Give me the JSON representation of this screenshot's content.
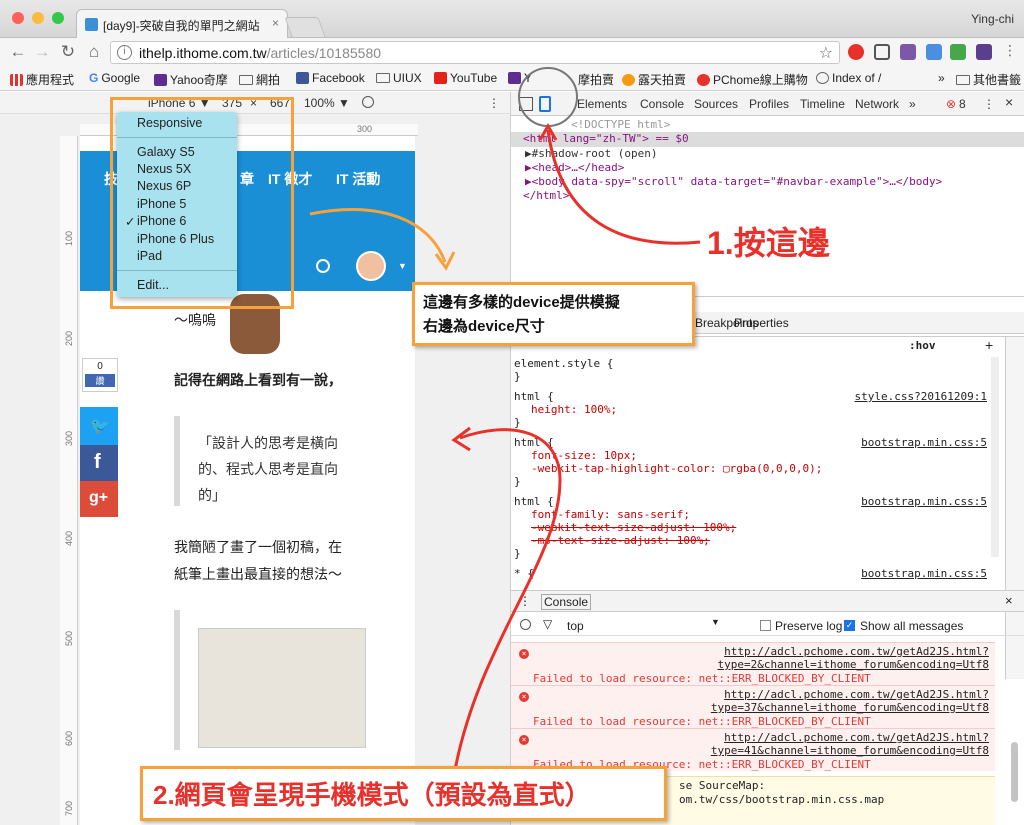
{
  "window": {
    "tab_title": "[day9]-突破自我的單門之網站",
    "user": "Ying-chi"
  },
  "address": {
    "host": "ithelp.ithome.com.tw",
    "path": "/articles/10185580"
  },
  "bookmarks": [
    "應用程式",
    "Google",
    "Yahoo奇摩",
    "網拍",
    "Facebook",
    "UIUX",
    "YouTube",
    "Y",
    "摩拍賣",
    "露天拍賣",
    "PChome線上購物",
    "Index of /",
    "»",
    "其他書籤"
  ],
  "device_toolbar": {
    "device": "iPhone 6 ▼",
    "width": "375",
    "times": "×",
    "height": "667",
    "zoom": "100% ▼"
  },
  "device_menu": {
    "items": [
      "Responsive",
      "Galaxy S5",
      "Nexus 5X",
      "Nexus 6P",
      "iPhone 5",
      "iPhone 6",
      "iPhone 6 Plus",
      "iPad",
      "Edit..."
    ],
    "checked": "✓"
  },
  "site": {
    "nav": [
      "技",
      "章",
      "IT 徵才",
      "IT 活動"
    ],
    "like_count": "0",
    "like_label": "讚",
    "text1": "～嗚嗚",
    "text2": "記得在網路上看到有一說，",
    "quote": [
      "「設計人的思考是橫向",
      "的、程式人思考是直向",
      "的」"
    ],
    "text3": [
      "我簡陋了畫了一個初稿，在",
      "紙筆上畫出最直接的想法～"
    ]
  },
  "ruler": {
    "top": [
      "100",
      "200",
      "300"
    ],
    "left": [
      "100",
      "200",
      "300",
      "400",
      "500",
      "600",
      "700"
    ]
  },
  "annotations": {
    "step1": "1.按這邊",
    "callout1": [
      "這邊有多樣的device提供模擬",
      "右邊為device尺寸"
    ],
    "step2": "2.網頁會呈現手機模式（預設為直式）"
  },
  "devtools": {
    "tabs": [
      "Elements",
      "Console",
      "Sources",
      "Profiles",
      "Timeline",
      "Network",
      "»"
    ],
    "error_count": "8",
    "dom": [
      "<!DOCTYPE html>",
      "<html lang=\"zh-TW\"> == $0",
      "▶#shadow-root (open)",
      "▶<head>…</head>",
      "▶<body data-spy=\"scroll\" data-target=\"#navbar-example\">…</body>",
      "</html>"
    ],
    "styles_tabs": [
      "Breakpoints",
      "Properties"
    ],
    "hov": ":hov",
    ".cls": ".cls",
    "plus": "+",
    "rules": [
      {
        "sel": "element.style {",
        "decls": [],
        "src": ""
      },
      {
        "sel": "html {",
        "decls": [
          "height: 100%;"
        ],
        "src": "style.css?20161209:1"
      },
      {
        "sel": "html {",
        "decls": [
          "font-size: 10px;",
          "-webkit-tap-highlight-color: ▢rgba(0,0,0,0);"
        ],
        "src": "bootstrap.min.css:5"
      },
      {
        "sel": "html {",
        "decls": [
          "font-family: sans-serif;",
          "-webkit-text-size-adjust: 100%;",
          "-ms-text-size-adjust: 100%;"
        ],
        "src": "bootstrap.min.css:5"
      },
      {
        "sel": "* {",
        "decls": [],
        "src": "bootstrap.min.css:5"
      }
    ],
    "console": {
      "tab": "Console",
      "filter": "top",
      "preserve": "Preserve log",
      "show_all": "Show all messages",
      "errors": [
        {
          "url1": "http://adcl.pchome.com.tw/getAd2JS.html?",
          "url2": "type=2&channel=ithome_forum&encoding=Utf8",
          "msg": "Failed to load resource: net::ERR_BLOCKED_BY_CLIENT"
        },
        {
          "url1": "http://adcl.pchome.com.tw/getAd2JS.html?",
          "url2": "type=37&channel=ithome_forum&encoding=Utf8",
          "msg": "Failed to load resource: net::ERR_BLOCKED_BY_CLIENT"
        },
        {
          "url1": "http://adcl.pchome.com.tw/getAd2JS.html?",
          "url2": "type=41&channel=ithome_forum&encoding=Utf8",
          "msg": "Failed to load resource: net::ERR_BLOCKED_BY_CLIENT"
        }
      ],
      "sourcemap1": "se SourceMap:",
      "sourcemap2": "om.tw/css/bootstrap.min.css.map"
    }
  }
}
